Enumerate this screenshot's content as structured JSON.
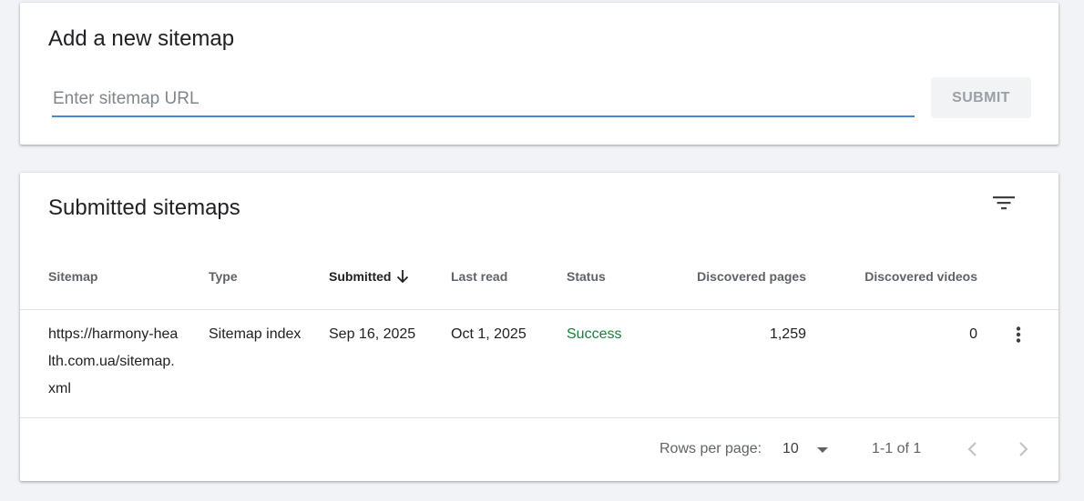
{
  "add_sitemap": {
    "title": "Add a new sitemap",
    "input_placeholder": "Enter sitemap URL",
    "input_value": "",
    "submit_label": "SUBMIT"
  },
  "submitted": {
    "title": "Submitted sitemaps",
    "filter_icon": "filter-list-icon",
    "sort_icon": "arrow-down-icon",
    "columns": {
      "sitemap": "Sitemap",
      "type": "Type",
      "submitted": "Submitted",
      "last_read": "Last read",
      "status": "Status",
      "discovered_pages": "Discovered pages",
      "discovered_videos": "Discovered videos"
    },
    "rows": [
      {
        "sitemap": "https://harmony-health.com.ua/sitemap.xml",
        "type": "Sitemap index",
        "submitted": "Sep 16, 2025",
        "last_read": "Oct 1, 2025",
        "status": "Success",
        "discovered_pages": "1,259",
        "discovered_videos": "0"
      }
    ],
    "pagination": {
      "rows_per_page_label": "Rows per page:",
      "rows_per_page_value": "10",
      "range": "1-1 of 1"
    }
  },
  "colors": {
    "background": "#f1f3f6",
    "accent": "#4a86d4",
    "success": "#188038",
    "muted": "#5f6368"
  }
}
